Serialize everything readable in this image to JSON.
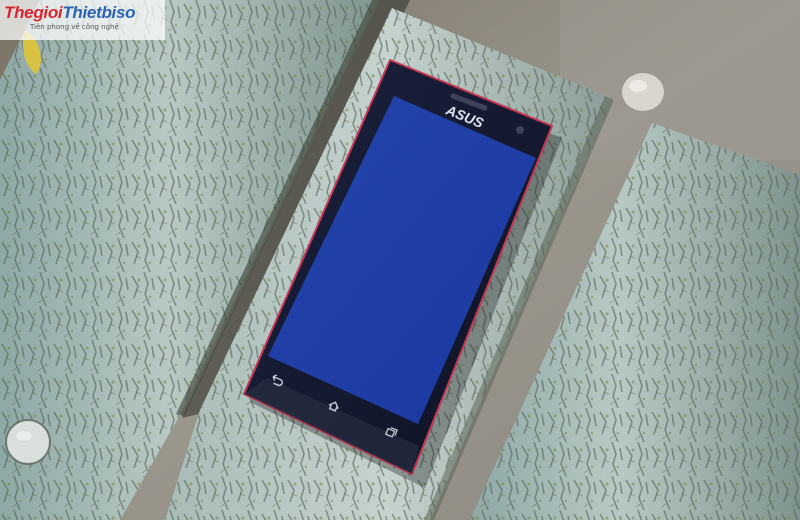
{
  "watermark": {
    "brand_part1": "Thegioi",
    "brand_part2": "Thietbiso",
    "tagline": "Tiên phong về công nghệ"
  },
  "phone": {
    "logo": "ASUS",
    "nav_icons": [
      "back-icon",
      "home-icon",
      "recent-apps-icon"
    ]
  },
  "colors": {
    "screen": "#1f3fa6",
    "phone_body": "#141a2c",
    "wood_weathered": "#9fb6b3",
    "ground": "#8e8a80"
  }
}
